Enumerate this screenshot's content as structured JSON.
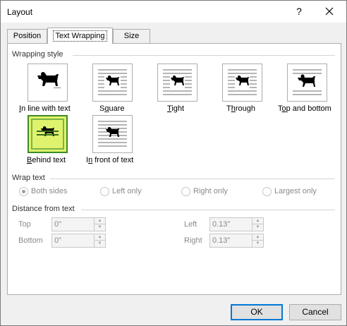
{
  "window": {
    "title": "Layout",
    "help_glyph": "?"
  },
  "tabs": [
    {
      "label": "Position"
    },
    {
      "label": "Text Wrapping"
    },
    {
      "label": "Size"
    }
  ],
  "wrapping_style": {
    "heading": "Wrapping style",
    "options": [
      {
        "pre": "",
        "u": "I",
        "post": "n line with text"
      },
      {
        "pre": "S",
        "u": "q",
        "post": "uare"
      },
      {
        "pre": "",
        "u": "T",
        "post": "ight"
      },
      {
        "pre": "T",
        "u": "h",
        "post": "rough"
      },
      {
        "pre": "T",
        "u": "o",
        "post": "p and bottom"
      },
      {
        "pre": "",
        "u": "B",
        "post": "ehind text"
      },
      {
        "pre": "I",
        "u": "n",
        "post": " front of text"
      }
    ],
    "selected": "Behind text"
  },
  "wrap_text": {
    "heading": "Wrap text",
    "options": [
      "Both sides",
      "Left only",
      "Right only",
      "Largest only"
    ],
    "selected": "Both sides"
  },
  "distance": {
    "heading": "Distance from text",
    "top": {
      "label": "Top",
      "value": "0\""
    },
    "bottom": {
      "label": "Bottom",
      "value": "0\""
    },
    "left": {
      "label": "Left",
      "value": "0.13\""
    },
    "right": {
      "label": "Right",
      "value": "0.13\""
    }
  },
  "buttons": {
    "ok": "OK",
    "cancel": "Cancel"
  }
}
